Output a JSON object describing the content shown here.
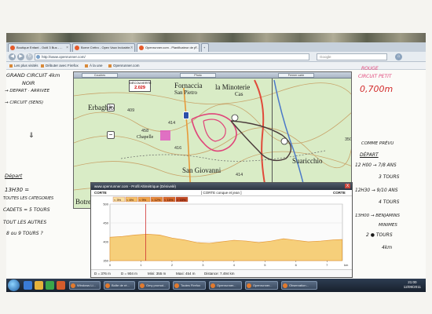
{
  "browser": {
    "tabs": [
      {
        "label": "Boutique Enfant - Outil 3 Bus - ..."
      },
      {
        "label": "Borne Crétro - Opex Vaux Industrie..."
      },
      {
        "label": "Openrunner.com - Planificateur de p..."
      }
    ],
    "new_tab": "+",
    "url": "http://www.openrunner.com/",
    "search_placeholder": "Google",
    "bookmarks": [
      "Les plus visités",
      "Débuter avec Firefox",
      "À la une",
      "Openrunner.com"
    ]
  },
  "map": {
    "panel_buttons": [
      "Couches",
      "Photo",
      "Fermer carte"
    ],
    "scale": {
      "label": "DÉCOUVERTE",
      "value": "2.029"
    },
    "places": [
      "Fornaccia",
      "San Pietro",
      "la Minoterie",
      "Cas",
      "Erbaghio",
      "Suaricchio",
      "San Giovanni",
      "Chapelle",
      "Botre"
    ],
    "heights": [
      "409",
      "414",
      "458",
      "416",
      "350",
      "414"
    ]
  },
  "profile": {
    "title": "www.openrunner.com - Profil Altimétrique (Dénivelé)",
    "close": "X",
    "start_label": "CORTE",
    "mid_label": "[ CORTE conque et jean ]",
    "end_label": "CORTE",
    "stats": {
      "dmin": "D = 376 m",
      "dmax": "D = 904 m",
      "min": "Mini: 355 m",
      "max": "Maxi: 454 m",
      "distance": "Distance: 7.494 km"
    },
    "y_ticks": [
      "500",
      "450",
      "400",
      "350"
    ],
    "x_ticks": [
      "0",
      "1",
      "2",
      "3",
      "4",
      "5",
      "6",
      "7"
    ],
    "x_unit": "km",
    "slope_legend": [
      "< 3%",
      "< 6%",
      "< 9%",
      "< 12%",
      "< 15%",
      "> 15%"
    ]
  },
  "taskbar": {
    "items": [
      "Windows Li...",
      "Boîte de ré...",
      "Gmy promot...",
      "Toutes Firefox",
      "Openrunner...",
      "Openrunner...",
      "Observation..."
    ],
    "time": "21:00",
    "date": "12/09/2011"
  },
  "notes": {
    "left": [
      "GRAND CIRCUIT 4km",
      "NOIR",
      "→ DEPART · ARRIVEE",
      "→ CIRCUIT (SENS)",
      "⇓",
      "Départ",
      "13H30 =",
      "TOUTES LES CATEGORIES",
      "CADETS = 5 TOURS",
      "TOUT LES AUTRES",
      "8 ou 9 TOURS ?"
    ],
    "right": [
      "ROUGE",
      "CIRCUIT PETIT",
      "0,700m",
      "COMME PRÉVU",
      "DÉPART",
      "12 H00 → 7/8 ANS",
      "3 TOURS",
      "12H30 → 9/10 ANS",
      "4 TOURS",
      "13H00 → BENJAMINS",
      "MINIMES",
      "2 ● TOURS",
      "4km"
    ]
  }
}
